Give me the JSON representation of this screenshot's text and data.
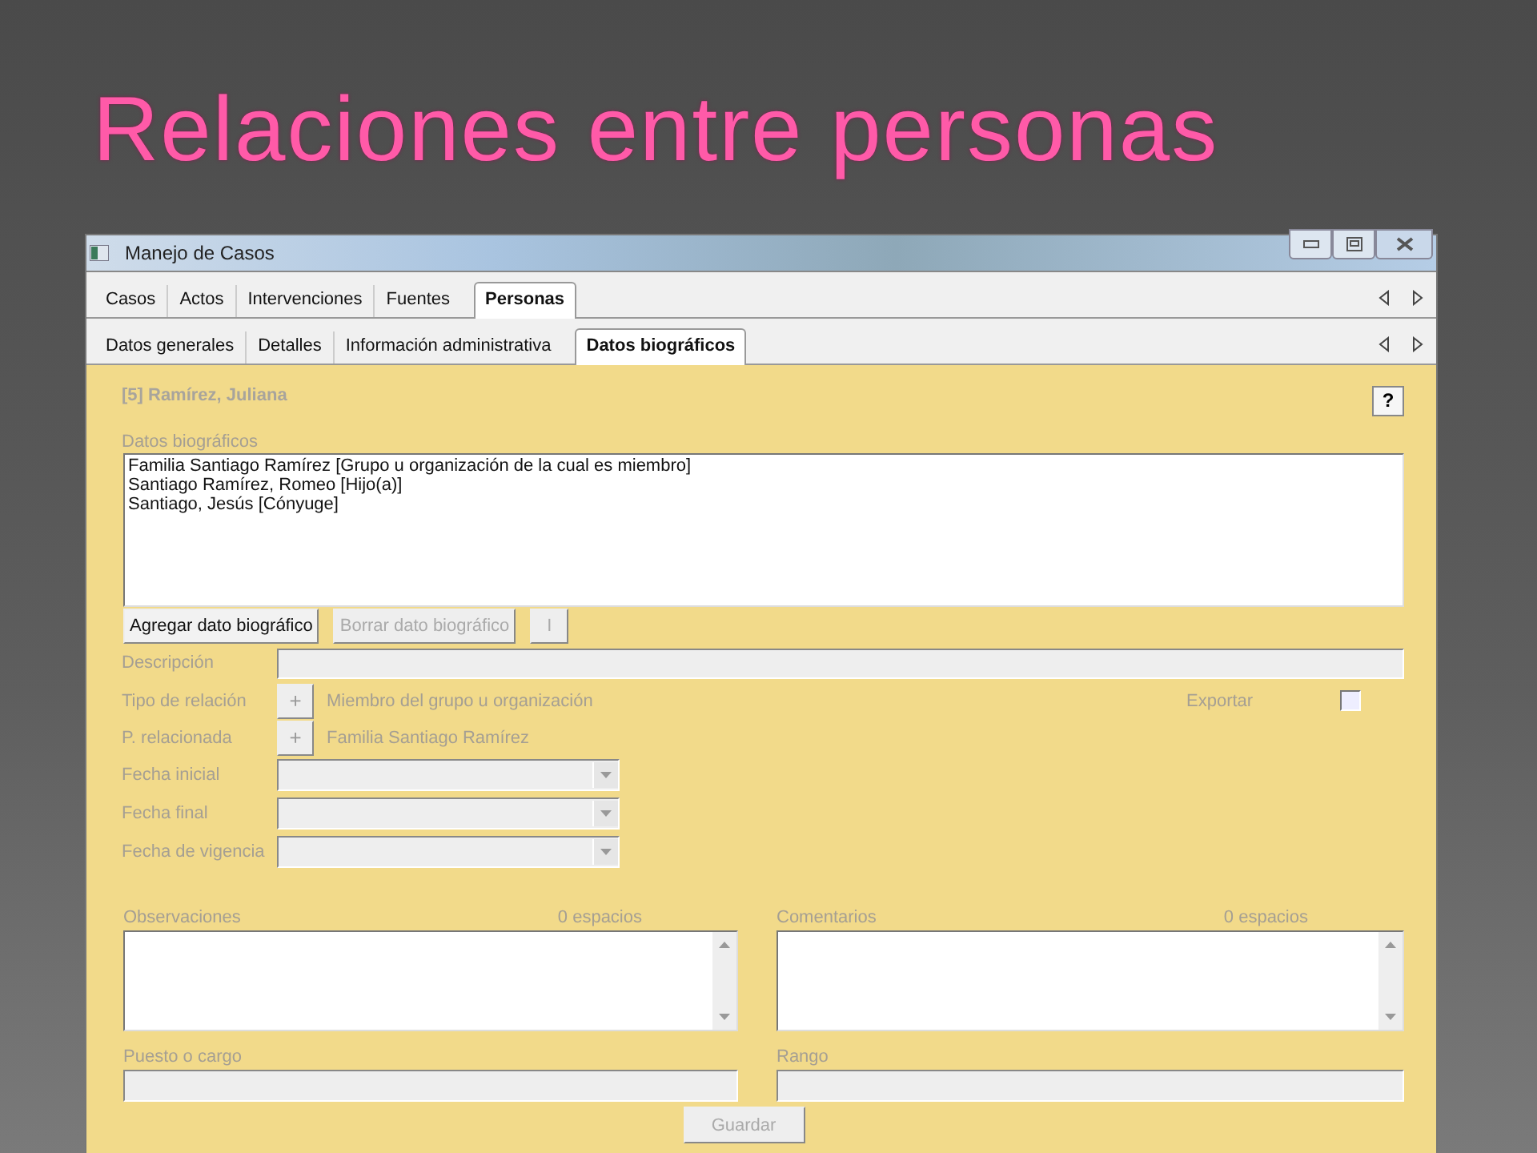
{
  "slide": {
    "title": "Relaciones entre personas"
  },
  "window": {
    "title": "Manejo de Casos"
  },
  "main_tabs": [
    {
      "label": "Casos",
      "selected": false
    },
    {
      "label": "Actos",
      "selected": false
    },
    {
      "label": "Intervenciones",
      "selected": false
    },
    {
      "label": "Fuentes",
      "selected": false
    },
    {
      "label": "Personas",
      "selected": true
    }
  ],
  "sub_tabs": [
    {
      "label": "Datos generales",
      "selected": false
    },
    {
      "label": "Detalles",
      "selected": false
    },
    {
      "label": "Información administrativa",
      "selected": false
    },
    {
      "label": "Datos biográficos",
      "selected": true
    }
  ],
  "person": "[5] Ramírez, Juliana",
  "help_button": "?",
  "biographic": {
    "label": "Datos biográficos",
    "items": [
      "Familia Santiago Ramírez [Grupo u organización de la cual es miembro]",
      "Santiago Ramírez, Romeo [Hijo(a)]",
      "Santiago, Jesús [Cónyuge]"
    ]
  },
  "buttons": [
    {
      "label": "Agregar dato biográfico",
      "disabled": false
    },
    {
      "label": "Borrar dato biográfico",
      "disabled": true
    },
    {
      "label": "I",
      "disabled": true
    }
  ],
  "description": {
    "label": "Descripción"
  },
  "relations": [
    {
      "label": "Tipo de relación",
      "button": "+",
      "value": "Miembro del grupo u organización"
    },
    {
      "label": "P. relacionada",
      "button": "+",
      "value": "Familia Santiago Ramírez"
    }
  ],
  "export": {
    "label": "Exportar",
    "checked": false
  },
  "dates": [
    {
      "label": "Fecha inicial"
    },
    {
      "label": "Fecha final"
    },
    {
      "label": "Fecha de vigencia"
    }
  ],
  "notes": [
    {
      "label": "Observaciones",
      "count": "0 espacios"
    },
    {
      "label": "Comentarios",
      "count": "0 espacios"
    }
  ],
  "inputs": [
    {
      "label": "Puesto o cargo"
    },
    {
      "label": "Rango"
    }
  ],
  "save_button": {
    "label": "Guardar",
    "disabled": true
  }
}
